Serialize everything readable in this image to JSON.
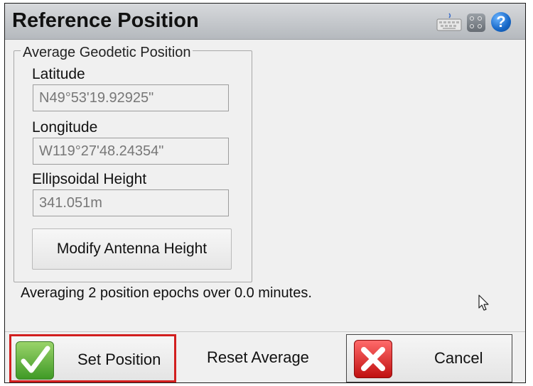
{
  "window": {
    "title": "Reference Position"
  },
  "header_icons": [
    "keyboard-icon",
    "keypad-grid-icon",
    "help-icon"
  ],
  "group": {
    "title": "Average Geodetic Position",
    "latitude": {
      "label": "Latitude",
      "value": "N49°53'19.92925\""
    },
    "longitude": {
      "label": "Longitude",
      "value": "W119°27'48.24354\""
    },
    "height": {
      "label": "Ellipsoidal Height",
      "value": "341.051m"
    },
    "modify_button": "Modify Antenna Height"
  },
  "status_text": "Averaging 2 position epochs over 0.0 minutes.",
  "buttons": {
    "set_position": "Set Position",
    "reset_average": "Reset Average",
    "cancel": "Cancel"
  },
  "colors": {
    "highlight_border": "#d21f1f",
    "help_blue": "#1667c7",
    "ok_green": "#3f9a26",
    "cancel_red": "#c01010"
  }
}
